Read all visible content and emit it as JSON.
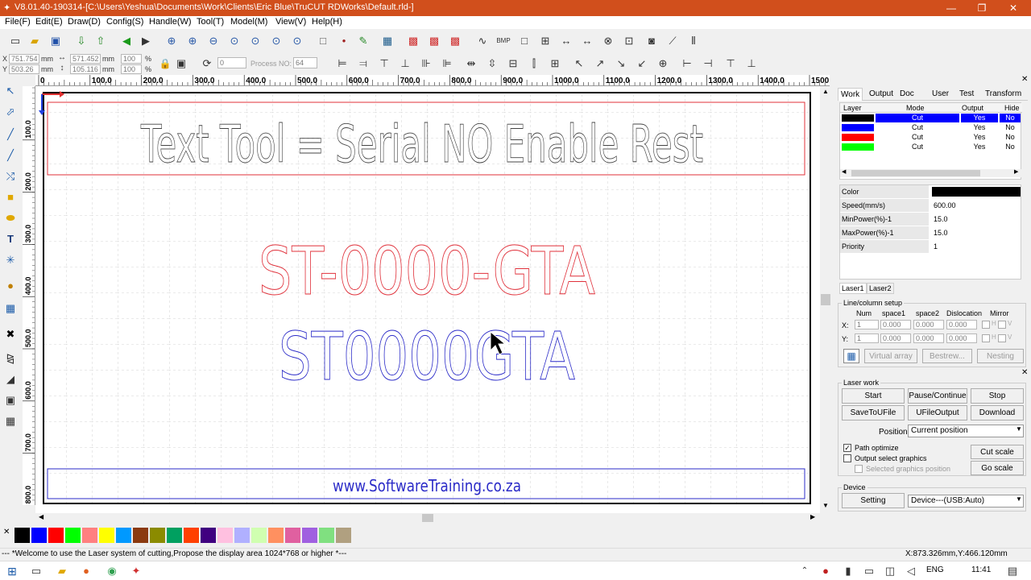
{
  "window": {
    "title": "V8.01.40-190314-[C:\\Users\\Yeshua\\Documents\\Work\\Clients\\Eric Blue\\TruCUT RDWorks\\Default.rld-]",
    "minimize": "—",
    "maximize": "❐",
    "close": "✕"
  },
  "menu": [
    "File(F)",
    "Edit(E)",
    "Draw(D)",
    "Config(S)",
    "Handle(W)",
    "Tool(T)",
    "Model(M)",
    "View(V)",
    "Help(H)"
  ],
  "props": {
    "x_label": "X",
    "y_label": "Y",
    "x_value": "751.754",
    "y_value": "503.26",
    "unit_mm": "mm",
    "w_value": "571.452",
    "h_value": "105.116",
    "scale_x": "100",
    "scale_y": "100",
    "percent": "%",
    "rotate_value": "0",
    "process_no_label": "Process NO:",
    "process_no_value": "64"
  },
  "ruler": {
    "h_ticks": [
      "0",
      "100.0",
      "200.0",
      "300.0",
      "400.0",
      "500.0",
      "600.0",
      "700.0",
      "800.0",
      "900.0",
      "1000.0",
      "1100.0",
      "1200.0",
      "1300.0",
      "1400.0",
      "1500.0"
    ],
    "v_ticks": [
      "100.0",
      "200.0",
      "300.0",
      "400.0",
      "500.0",
      "600.0",
      "700.0",
      "800.0"
    ]
  },
  "canvas": {
    "text_title": "Text Tool = Serial NO Enable Rest",
    "text_serial_dash": "ST-0000-GTA",
    "text_serial_plain": "ST0000GTA",
    "text_website": "www.SoftwareTraining.co.za",
    "color_red": "#e0303a",
    "color_blue": "#2b2bc8"
  },
  "right": {
    "tabs": [
      "Work",
      "Output",
      "Doc",
      "User",
      "Test",
      "Transform"
    ],
    "layer_headers": [
      "Layer",
      "Mode",
      "Output",
      "Hide"
    ],
    "layers": [
      {
        "color": "#000000",
        "mode": "Cut",
        "output": "Yes",
        "hide": "No"
      },
      {
        "color": "#0000ff",
        "mode": "Cut",
        "output": "Yes",
        "hide": "No"
      },
      {
        "color": "#ff0000",
        "mode": "Cut",
        "output": "Yes",
        "hide": "No"
      },
      {
        "color": "#00ff00",
        "mode": "Cut",
        "output": "Yes",
        "hide": "No"
      }
    ],
    "params": [
      {
        "label": "Color",
        "value": ""
      },
      {
        "label": "Speed(mm/s)",
        "value": "600.00"
      },
      {
        "label": "MinPower(%)-1",
        "value": "15.0"
      },
      {
        "label": "MaxPower(%)-1",
        "value": "15.0"
      },
      {
        "label": "Priority",
        "value": "1"
      }
    ],
    "laser_tabs": [
      "Laser1",
      "Laser2"
    ],
    "linecol": {
      "title": "Line/column setup",
      "headers": [
        "Num",
        "space1",
        "space2",
        "Dislocation",
        "Mirror"
      ],
      "x_label": "X:",
      "y_label": "Y:",
      "x_vals": [
        "1",
        "0.000",
        "0.000",
        "0.000"
      ],
      "y_vals": [
        "1",
        "0.000",
        "0.000",
        "0.000"
      ],
      "h": "H",
      "v": "V",
      "virtual_array": "Virtual array",
      "bestrew": "Bestrew...",
      "nesting": "Nesting"
    },
    "laserwork": {
      "title": "Laser work",
      "start": "Start",
      "pause": "Pause/Continue",
      "stop": "Stop",
      "save_u": "SaveToUFile",
      "ufile_output": "UFileOutput",
      "download": "Download",
      "position_label": "Position:",
      "position_value": "Current position",
      "path_optimize": "Path optimize",
      "output_select": "Output select graphics",
      "selected_pos": "Selected graphics position",
      "cut_scale": "Cut scale",
      "go_scale": "Go scale"
    },
    "device": {
      "title": "Device",
      "setting": "Setting",
      "value": "Device---(USB:Auto)"
    }
  },
  "palette_colors": [
    "#000000",
    "#0000ff",
    "#ff0000",
    "#00ff00",
    "#ff8080",
    "#ffff00",
    "#0099ff",
    "#8b3a0f",
    "#8b8b00",
    "#00a060",
    "#ff4000",
    "#400080",
    "#ffc0e0",
    "#b0b0ff",
    "#d0ffb0",
    "#ff9060",
    "#e060a0",
    "#a060e0",
    "#80e080",
    "#b0a080"
  ],
  "status": {
    "message": "--- *Welcome to use the Laser system of cutting,Propose the display area 1024*768 or higher *---",
    "coords": "X:873.326mm,Y:466.120mm"
  },
  "taskbar": {
    "lang": "ENG",
    "time": "11:41"
  }
}
